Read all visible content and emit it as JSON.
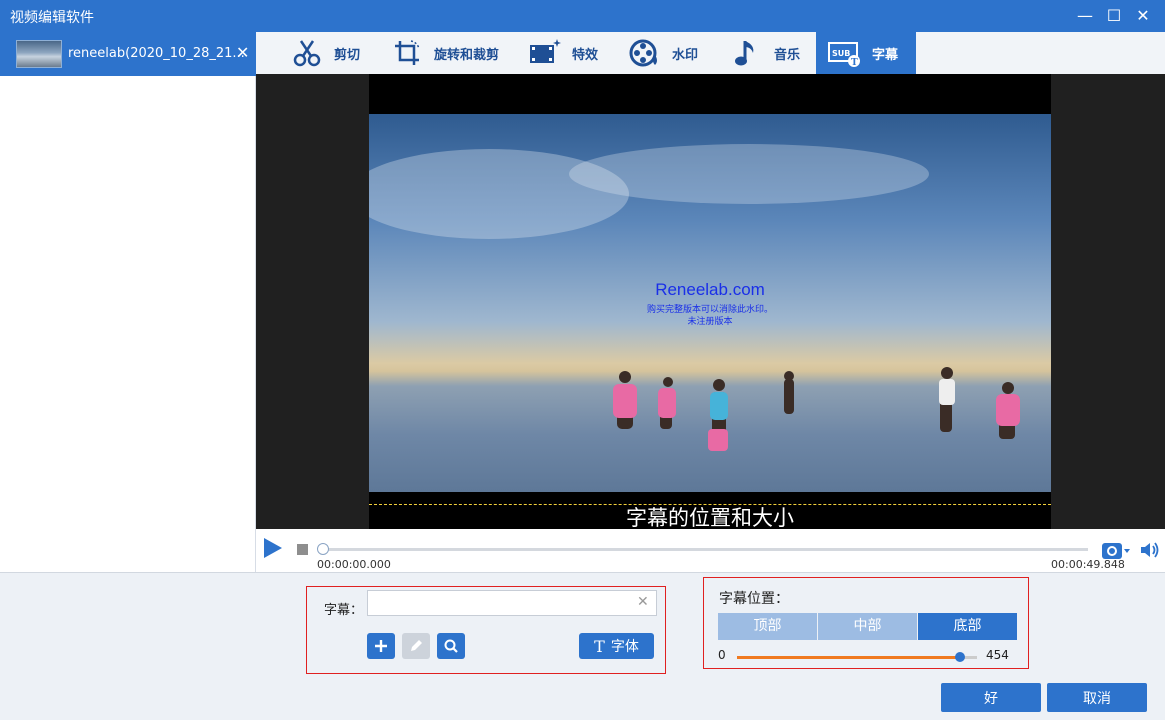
{
  "window": {
    "title": "视频编辑软件"
  },
  "file_tab": {
    "name": "reneelab(2020_10_28_21...",
    "close": "✕"
  },
  "toolbar": {
    "tabs": [
      {
        "label": "剪切",
        "icon": "scissors-icon"
      },
      {
        "label": "旋转和裁剪",
        "icon": "crop-rotate-icon"
      },
      {
        "label": "特效",
        "icon": "effects-icon"
      },
      {
        "label": "水印",
        "icon": "watermark-icon"
      },
      {
        "label": "音乐",
        "icon": "music-note-icon"
      },
      {
        "label": "字幕",
        "icon": "subtitle-icon",
        "active": true
      }
    ]
  },
  "preview": {
    "watermark_site": "Reneelab.com",
    "watermark_line1": "购买完整版本可以消除此水印。",
    "watermark_line2": "未注册版本",
    "subtitle_overlay": "字幕的位置和大小"
  },
  "player": {
    "current_time": "00:00:00.000",
    "total_time": "00:00:49.848",
    "progress": 0
  },
  "subtitle_panel": {
    "label": "字幕：",
    "input_value": "",
    "clear": "✕",
    "font_button": "字体",
    "font_icon": "T"
  },
  "position_panel": {
    "label": "字幕位置：",
    "options": [
      "顶部",
      "中部",
      "底部"
    ],
    "selected": "底部",
    "slider_min": "0",
    "slider_value": "454"
  },
  "footer": {
    "ok": "好",
    "cancel": "取消"
  },
  "colors": {
    "accent": "#2d73cc",
    "highlight_border": "#e02020",
    "slider_fill": "#f07a20"
  }
}
